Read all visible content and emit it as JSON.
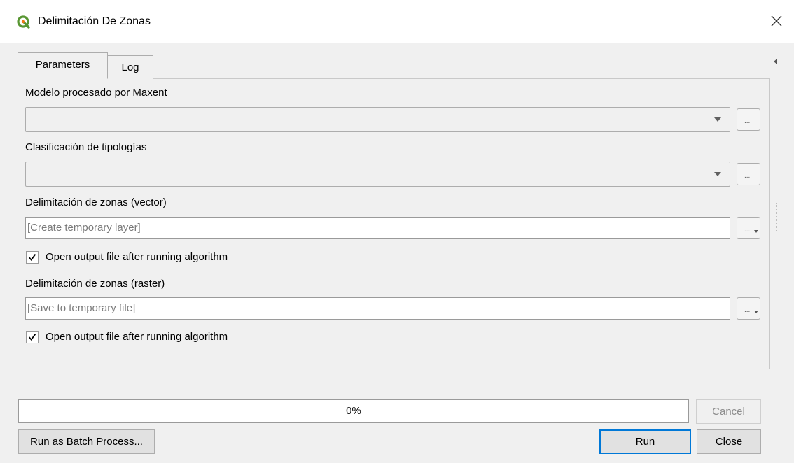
{
  "window": {
    "title": "Delimitación De Zonas",
    "close_icon": "close-icon",
    "app_icon": "qgis-logo-icon"
  },
  "tabs": [
    {
      "label": "Parameters",
      "active": true
    },
    {
      "label": "Log",
      "active": false
    }
  ],
  "parameters": {
    "maxent_label": "Modelo procesado por Maxent",
    "maxent_value": "",
    "tipologias_label": "Clasificación de tipologías",
    "tipologias_value": "",
    "vector_label": "Delimitación de zonas (vector)",
    "vector_placeholder": "[Create temporary layer]",
    "vector_open_label": "Open output file after running algorithm",
    "vector_open_checked": true,
    "raster_label": "Delimitación de zonas (raster)",
    "raster_placeholder": "[Save to temporary file]",
    "raster_open_label": "Open output file after running algorithm",
    "raster_open_checked": true,
    "browse_label": "..."
  },
  "progress": {
    "text": "0%",
    "value": 0
  },
  "buttons": {
    "cancel": "Cancel",
    "batch": "Run as Batch Process...",
    "run": "Run",
    "close": "Close"
  },
  "colors": {
    "qgis_green": "#589632",
    "qgis_yellow": "#ee7913",
    "accent": "#0078d7"
  }
}
